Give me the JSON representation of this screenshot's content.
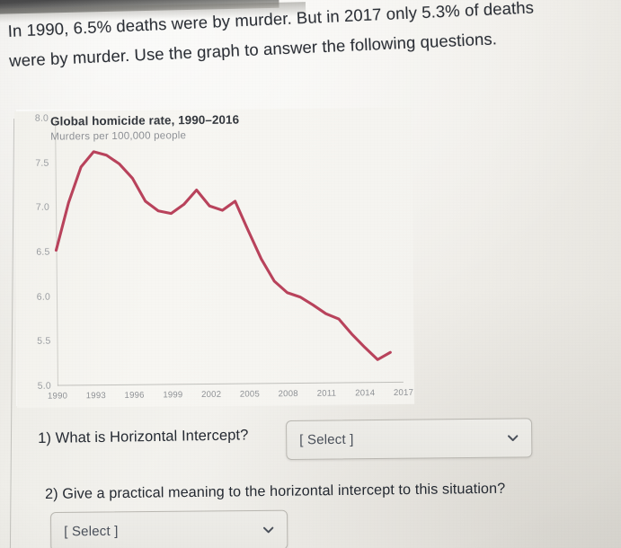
{
  "prompt": {
    "line1": "In 1990, 6.5% deaths were by murder. But in 2017 only 5.3% of deaths",
    "line2": "were by murder. Use the graph to answer the following questions."
  },
  "chart_data": {
    "type": "line",
    "title": "Global homicide rate, 1990–2016",
    "subtitle": "Murders per 100,000 people",
    "xlabel": "",
    "ylabel": "Murders per 100,000 people",
    "xlim": [
      1990,
      2017
    ],
    "ylim": [
      5.0,
      8.0
    ],
    "grid": false,
    "legend": "none",
    "line_color": "#b9435c",
    "y_ticks": [
      "8.0",
      "7.5",
      "7.0",
      "6.5",
      "6.0",
      "5.5",
      "5.0"
    ],
    "y_tick_values": [
      8.0,
      7.5,
      7.0,
      6.5,
      6.0,
      5.5,
      5.0
    ],
    "x_ticks": [
      "1990",
      "1993",
      "1996",
      "1999",
      "2002",
      "2005",
      "2008",
      "2011",
      "2014",
      "2017"
    ],
    "x_tick_values": [
      1990,
      1993,
      1996,
      1999,
      2002,
      2005,
      2008,
      2011,
      2014,
      2017
    ],
    "x": [
      1990,
      1991,
      1992,
      1993,
      1994,
      1995,
      1996,
      1997,
      1998,
      1999,
      2000,
      2001,
      2002,
      2003,
      2004,
      2005,
      2006,
      2007,
      2008,
      2009,
      2010,
      2011,
      2012,
      2013,
      2014,
      2015,
      2016
    ],
    "values": [
      6.52,
      7.05,
      7.45,
      7.62,
      7.58,
      7.48,
      7.32,
      7.06,
      6.95,
      6.92,
      7.02,
      7.18,
      7.0,
      6.95,
      7.05,
      6.72,
      6.4,
      6.15,
      6.02,
      5.97,
      5.88,
      5.78,
      5.72,
      5.55,
      5.4,
      5.26,
      5.34
    ],
    "series": [
      {
        "name": "Global homicide rate",
        "color": "#b9435c",
        "values": [
          6.52,
          7.05,
          7.45,
          7.62,
          7.58,
          7.48,
          7.32,
          7.06,
          6.95,
          6.92,
          7.02,
          7.18,
          7.0,
          6.95,
          7.05,
          6.72,
          6.4,
          6.15,
          6.02,
          5.97,
          5.88,
          5.78,
          5.72,
          5.55,
          5.4,
          5.26,
          5.34
        ]
      }
    ]
  },
  "questions": [
    {
      "number": "1)",
      "text": "1) What is Horizontal Intercept?",
      "select_value": "[ Select ]",
      "chevron": "chevron-down-icon"
    },
    {
      "number": "2)",
      "text": "2) Give a practical meaning to the horizontal intercept to this situation?",
      "select_value": "[ Select ]",
      "chevron": "chevron-down-icon"
    }
  ]
}
